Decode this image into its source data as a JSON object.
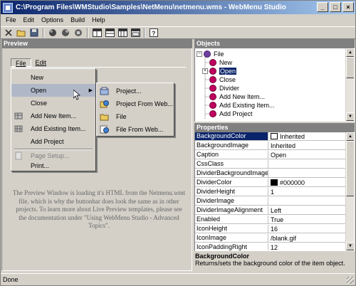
{
  "window": {
    "title": "C:\\Program Files\\WMStudio\\Samples\\NetMenu\\netmenu.wms - WebMenu Studio",
    "min_glyph": "_",
    "max_glyph": "□",
    "close_glyph": "×"
  },
  "menubar": [
    "File",
    "Edit",
    "Options",
    "Build",
    "Help"
  ],
  "toolbar_icons": [
    "close-doc-icon",
    "open-icon",
    "save-icon",
    "add-item-icon",
    "remove-item-icon",
    "item-props-icon",
    "layout-1-icon",
    "layout-2-icon",
    "layout-3-icon",
    "layout-4-icon",
    "help-icon"
  ],
  "preview": {
    "header": "Preview",
    "menubar": [
      "File",
      "Edit"
    ],
    "file_menu": [
      {
        "label": "New",
        "icon": "",
        "disabled": false
      },
      {
        "label": "Open",
        "icon": "",
        "submenu": true,
        "active": true
      },
      {
        "label": "Close",
        "icon": ""
      },
      {
        "label": "Add New Item...",
        "icon": "add-new-item-icon"
      },
      {
        "label": "Add Existing Item...",
        "icon": "add-existing-item-icon"
      },
      {
        "label": "Add Project",
        "icon": ""
      },
      {
        "label": "Page Setup...",
        "icon": "page-setup-icon",
        "disabled": true
      },
      {
        "label": "Print...",
        "icon": ""
      }
    ],
    "open_submenu": [
      {
        "label": "Project...",
        "icon": "project-icon"
      },
      {
        "label": "Project From Web...",
        "icon": "project-web-icon"
      },
      {
        "label": "File",
        "icon": "file-icon"
      },
      {
        "label": "File From Web...",
        "icon": "file-web-icon"
      }
    ],
    "note": "The Preview Window is loading it's HTML from the Netmenu.wmt file, which is why the buttonbar does look the same as in other projects. To learn more about Live Preview templates, please see the documentation under \"Using WebMenu Studio - Advanced Topics\"."
  },
  "objects": {
    "header": "Objects",
    "tree": [
      {
        "label": "File",
        "root": true
      },
      {
        "label": "New"
      },
      {
        "label": "Open",
        "selected": true,
        "expandable": true
      },
      {
        "label": "Close"
      },
      {
        "label": "Divider"
      },
      {
        "label": "Add New Item..."
      },
      {
        "label": "Add Existing Item..."
      },
      {
        "label": "Add Project"
      }
    ],
    "expand_glyph": "+"
  },
  "properties": {
    "header": "Properties",
    "rows": [
      {
        "key": "BackgroundColor",
        "value": "Inherited",
        "swatch": "#ffffff",
        "selected": true
      },
      {
        "key": "BackgroundImage",
        "value": "Inherited"
      },
      {
        "key": "Caption",
        "value": "Open"
      },
      {
        "key": "CssClass",
        "value": ""
      },
      {
        "key": "DividerBackgroundImage",
        "value": ""
      },
      {
        "key": "DividerColor",
        "value": "#000000",
        "swatch": "#000000"
      },
      {
        "key": "DividerHeight",
        "value": "1"
      },
      {
        "key": "DividerImage",
        "value": ""
      },
      {
        "key": "DividerImageAlignment",
        "value": "Left"
      },
      {
        "key": "Enabled",
        "value": "True"
      },
      {
        "key": "IconHeight",
        "value": "16"
      },
      {
        "key": "IconImage",
        "value": "/blank.gif"
      },
      {
        "key": "IconPaddingRight",
        "value": "12"
      }
    ],
    "description_title": "BackgroundColor",
    "description_text": "Returns/sets the background color of the item object."
  },
  "status": "Done"
}
